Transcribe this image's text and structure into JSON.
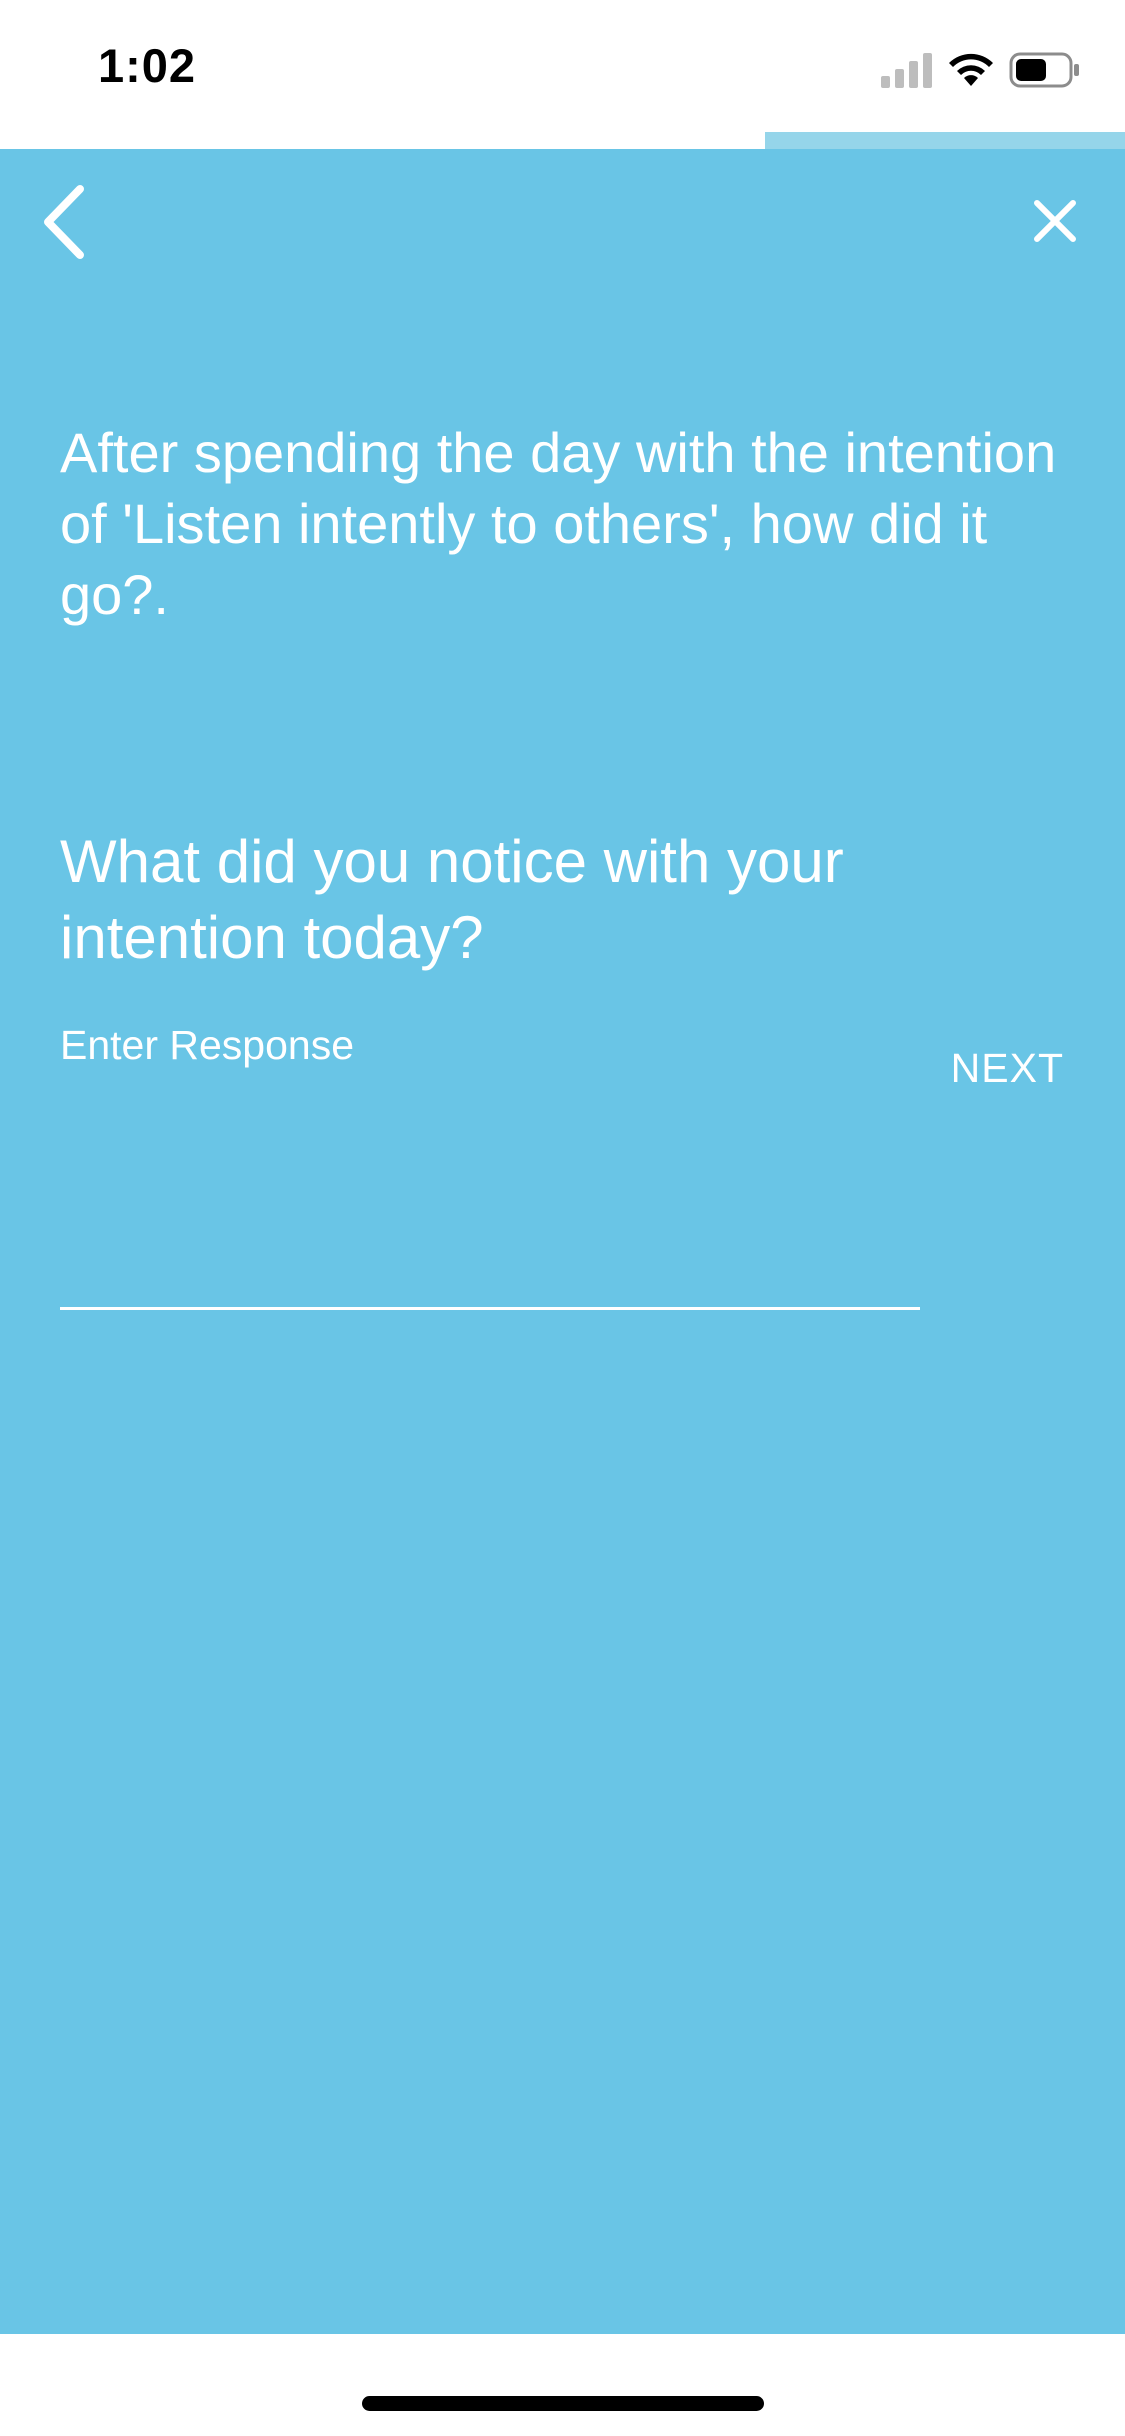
{
  "status_bar": {
    "time": "1:02",
    "icons": [
      "cellular-signal-icon",
      "wifi-icon",
      "battery-icon"
    ]
  },
  "progress": {
    "fraction": 0.32,
    "fill_color": "#95d5ea"
  },
  "theme": {
    "background": "#69c5e6",
    "text": "#ffffff"
  },
  "header": {
    "back_icon": "chevron-left-icon",
    "close_icon": "close-icon"
  },
  "prompt": {
    "text": "After spending the day with the intention of 'Listen intently to others', how did it go?."
  },
  "question": {
    "text": "What did you notice with your intention today?"
  },
  "response": {
    "placeholder": "Enter Response",
    "value": ""
  },
  "actions": {
    "next_label": "NEXT"
  }
}
